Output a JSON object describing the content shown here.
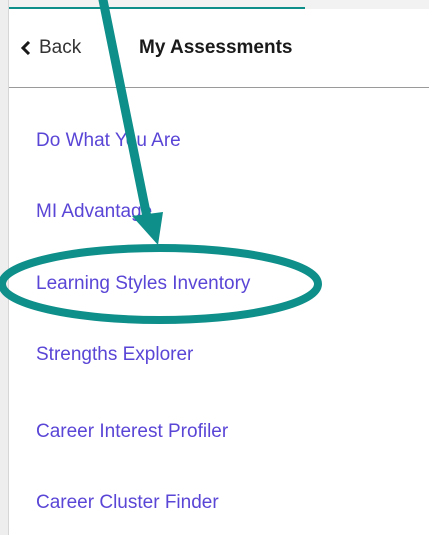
{
  "header": {
    "back_label": "Back",
    "title": "My Assessments",
    "back_icon": "chevron-left-icon"
  },
  "menu": {
    "items": [
      {
        "label": "Do What You Are"
      },
      {
        "label": "MI Advantage"
      },
      {
        "label": "Learning Styles Inventory"
      },
      {
        "label": "Strengths Explorer"
      },
      {
        "label": "Career Interest Profiler"
      },
      {
        "label": "Career Cluster Finder"
      }
    ]
  },
  "colors": {
    "link": "#5a46d6",
    "annotation": "#0e8f8a",
    "divider": "#9a9a9a"
  },
  "annotation": {
    "highlighted_item": "Learning Styles Inventory",
    "shapes": [
      "arrow-annotation",
      "ellipse-annotation"
    ]
  }
}
